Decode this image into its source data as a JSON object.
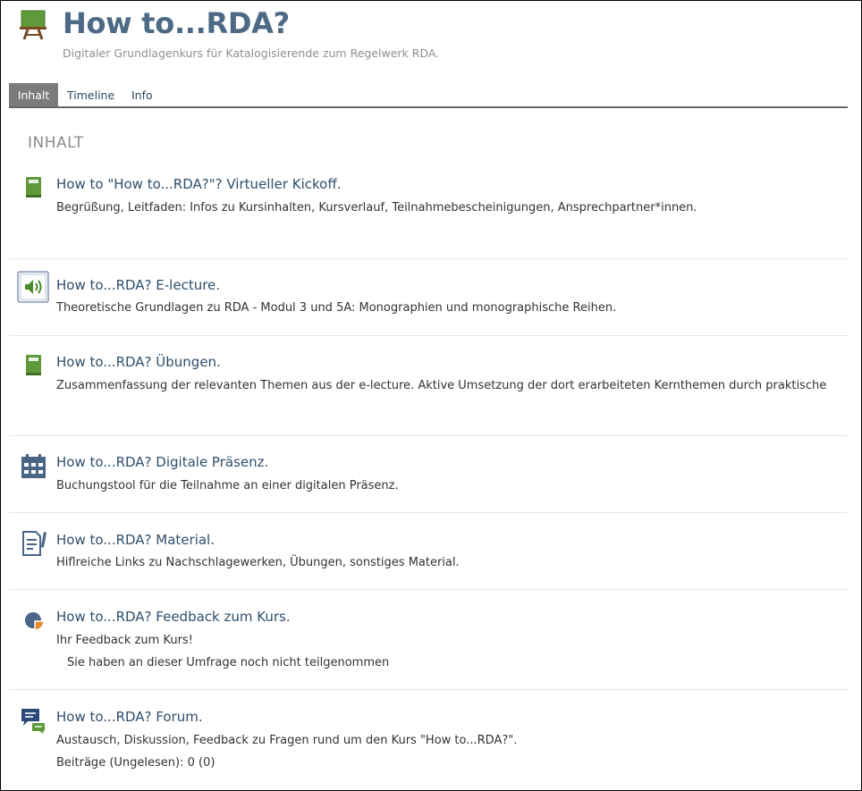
{
  "course": {
    "title": "How to...RDA?",
    "subtitle": "Digitaler Grundlagenkurs für Katalogisierende zum Regelwerk RDA.",
    "icon": "presentation-easel-icon"
  },
  "tabs": [
    {
      "label": "Inhalt",
      "active": true
    },
    {
      "label": "Timeline",
      "active": false
    },
    {
      "label": "Info",
      "active": false
    }
  ],
  "section_title": "INHALT",
  "items": [
    {
      "icon": "book-icon",
      "title": "How to \"How to...RDA?\"? Virtueller Kickoff.",
      "desc": "Begrüßung, Leitfaden: Infos zu Kursinhalten, Kursverlauf, Teilnahmebescheinigungen, Ansprechpartner*innen."
    },
    {
      "icon": "audio-speaker-icon",
      "title": "How to...RDA? E-lecture.",
      "desc": "Theoretische Grundlagen zu RDA - Modul 3 und 5A: Monographien und monographische Reihen."
    },
    {
      "icon": "book-icon",
      "title": "How to...RDA? Übungen.",
      "desc": "Zusammenfassung der relevanten Themen aus der e-lecture. Aktive Umsetzung der dort erarbeiteten Kernthemen durch praktische"
    },
    {
      "icon": "calendar-icon",
      "title": "How to...RDA? Digitale Präsenz.",
      "desc": "Buchungstool für die Teilnahme an einer digitalen Präsenz."
    },
    {
      "icon": "document-pen-icon",
      "title": "How to...RDA? Material.",
      "desc": "Hiflreiche Links zu Nachschlagewerken, Übungen, sonstiges Material."
    },
    {
      "icon": "pie-chart-icon",
      "title": "How to...RDA? Feedback zum Kurs.",
      "desc": "Ihr Feedback zum Kurs!",
      "sub": "Sie haben an dieser Umfrage noch nicht teilgenommen"
    },
    {
      "icon": "forum-chat-icon",
      "title": "How to...RDA? Forum.",
      "desc": "Austausch, Diskussion, Feedback zu Fragen rund um den Kurs \"How to...RDA?\".",
      "sub": "Beiträge (Ungelesen): 0 (0)"
    }
  ],
  "colors": {
    "title": "#4c6a86",
    "link": "#2f4e6b",
    "active_tab": "#7b7b7b",
    "book_green": "#5f9a3a",
    "icon_blue": "#4a6585",
    "pie_orange": "#e8892a"
  }
}
